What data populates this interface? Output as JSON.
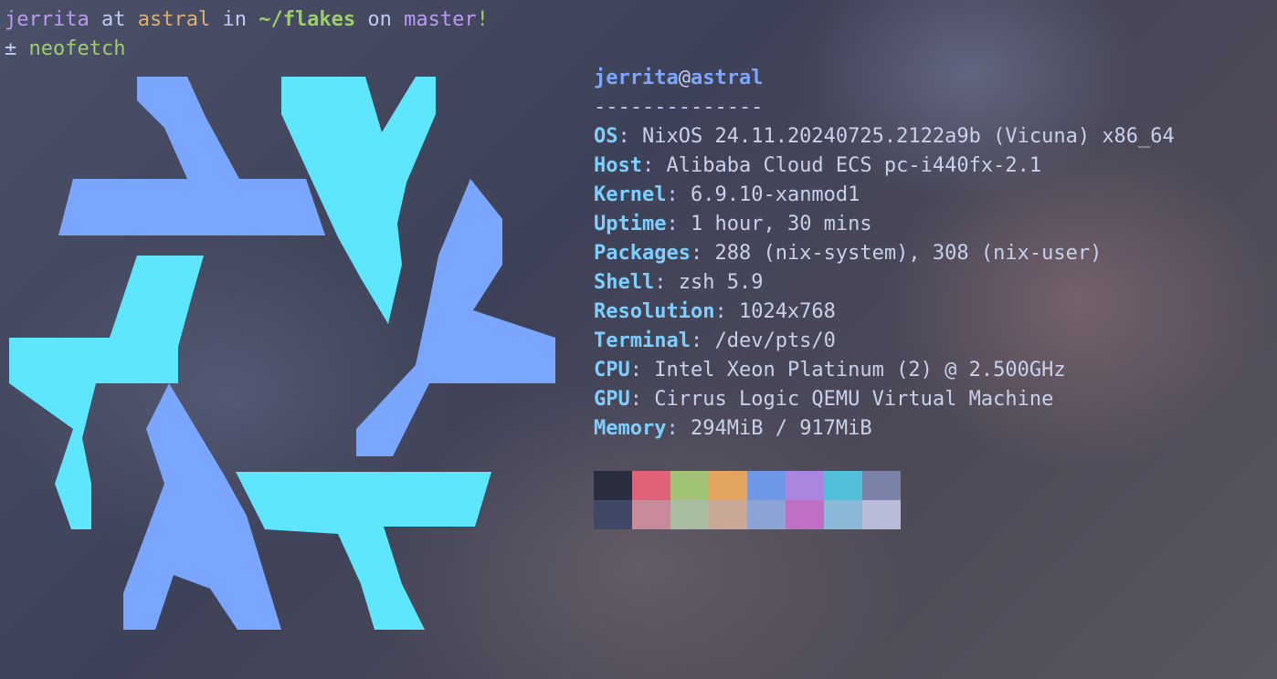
{
  "prompt": {
    "user": "jerrita",
    "at": "at",
    "host": "astral",
    "in": "in",
    "directory": "~/flakes",
    "on": "on",
    "branch": "master",
    "dirty_marker": "!",
    "vcs_symbol": "±",
    "command": "neofetch"
  },
  "neofetch": {
    "user": "jerrita",
    "at": "@",
    "host": "astral",
    "separator": "--------------",
    "fields": [
      {
        "key": "OS",
        "value": "NixOS 24.11.20240725.2122a9b (Vicuna) x86_64"
      },
      {
        "key": "Host",
        "value": "Alibaba Cloud ECS pc-i440fx-2.1"
      },
      {
        "key": "Kernel",
        "value": "6.9.10-xanmod1"
      },
      {
        "key": "Uptime",
        "value": "1 hour, 30 mins"
      },
      {
        "key": "Packages",
        "value": "288 (nix-system), 308 (nix-user)"
      },
      {
        "key": "Shell",
        "value": "zsh 5.9"
      },
      {
        "key": "Resolution",
        "value": "1024x768"
      },
      {
        "key": "Terminal",
        "value": "/dev/pts/0"
      },
      {
        "key": "CPU",
        "value": "Intel Xeon Platinum (2) @ 2.500GHz"
      },
      {
        "key": "GPU",
        "value": "Cirrus Logic QEMU Virtual Machine"
      },
      {
        "key": "Memory",
        "value": "294MiB / 917MiB"
      }
    ],
    "palette": {
      "normal": [
        "#2a2d3e",
        "#e06278",
        "#a2c275",
        "#e4a560",
        "#6e97e6",
        "#a986e0",
        "#52c0d8",
        "#7a82a8"
      ],
      "bright": [
        "#404868",
        "#c98a9c",
        "#a9bda0",
        "#c9a898",
        "#8aa4d6",
        "#c070c4",
        "#8ab8d8",
        "#b8bcd8"
      ]
    }
  },
  "logo": {
    "name": "nixos-logo",
    "colors": {
      "light": "#7aa6ff",
      "dark": "#5ee6ff"
    }
  }
}
